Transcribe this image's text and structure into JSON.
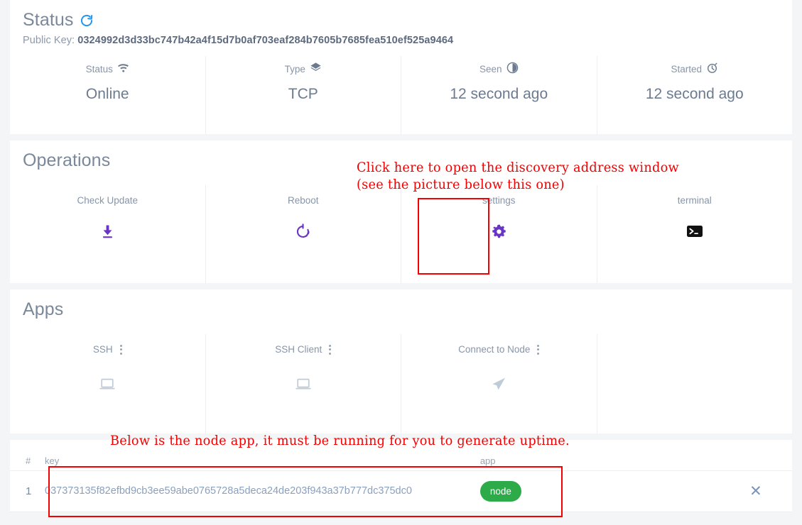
{
  "status": {
    "title": "Status",
    "refresh_icon": "refresh-icon",
    "public_key_label": "Public Key:",
    "public_key": "0324992d3d33bc747b42a4f15d7b0af703eaf284b7605b7685fea510ef525a9464",
    "cells": [
      {
        "label": "Status",
        "icon": "wifi-icon",
        "value": "Online"
      },
      {
        "label": "Type",
        "icon": "layers-icon",
        "value": "TCP"
      },
      {
        "label": "Seen",
        "icon": "clock-icon",
        "value": "12 second ago"
      },
      {
        "label": "Started",
        "icon": "stopwatch-icon",
        "value": "12 second ago"
      }
    ]
  },
  "operations": {
    "title": "Operations",
    "items": [
      {
        "label": "Check Update",
        "icon": "download-icon"
      },
      {
        "label": "Reboot",
        "icon": "restart-icon"
      },
      {
        "label": "settings",
        "icon": "gear-icon"
      },
      {
        "label": "terminal",
        "icon": "terminal-icon"
      }
    ]
  },
  "apps": {
    "title": "Apps",
    "items": [
      {
        "label": "SSH",
        "icon": "laptop-icon",
        "menu_icon": "kebab-menu-icon"
      },
      {
        "label": "SSH Client",
        "icon": "laptop-icon",
        "menu_icon": "kebab-menu-icon"
      },
      {
        "label": "Connect to Node",
        "icon": "paper-plane-icon",
        "menu_icon": "kebab-menu-icon"
      }
    ]
  },
  "table": {
    "headers": {
      "num": "#",
      "key": "key",
      "app": "app"
    },
    "rows": [
      {
        "num": "1",
        "key": "037373135f82efbd9cb3ee59abe0765728a5deca24de203f943a37b777dc375dc0",
        "app": "node",
        "close_icon": "close-icon"
      }
    ]
  },
  "annotations": {
    "settings": "Click here to open the discovery address window\n(see the picture below this one)",
    "node": "Below is the node app, it must be running for you to generate uptime."
  },
  "colors": {
    "annotation_red": "#f40000",
    "accent_purple": "#6a35c4",
    "refresh_blue": "#2196f3",
    "badge_green": "#2cab48",
    "text_gray": "#7a889c",
    "page_bg": "#f4f5f7"
  }
}
